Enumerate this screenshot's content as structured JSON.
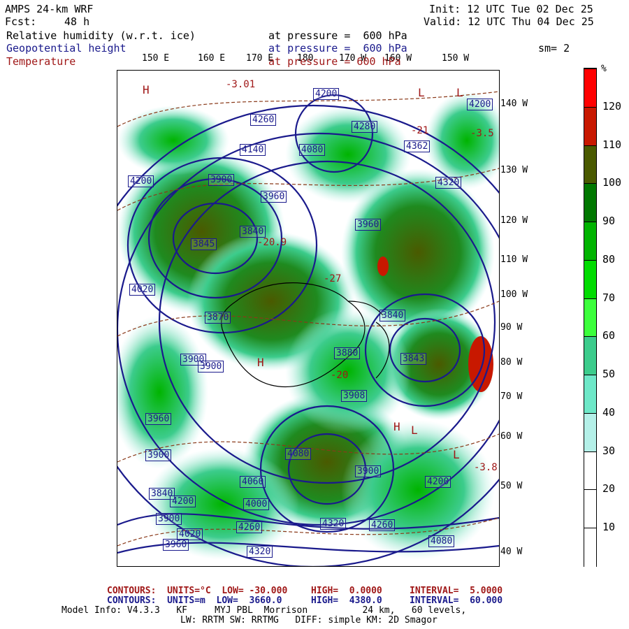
{
  "header": {
    "model": "AMPS 24-km WRF",
    "fcst_label": "Fcst:",
    "fcst_value": "48 h",
    "init": "Init: 12 UTC Tue 02 Dec 25",
    "valid": "Valid: 12 UTC Thu 04 Dec 25",
    "field1_name": "Relative humidity (w.r.t. ice)",
    "field1_level": "at pressure =  600 hPa",
    "field2_name": "Geopotential height",
    "field2_level": "at pressure =  600 hPa",
    "field3_name": "Temperature",
    "field3_level": "at pressure = 600 hPa",
    "smoothing": "sm= 2"
  },
  "lon_labels_top": [
    "150 E",
    "160 E",
    "170 E",
    "180",
    "170 W",
    "160 W",
    "150 W"
  ],
  "lat_lon_labels_right": [
    "140 W",
    "130 W",
    "120 W",
    "110 W",
    "100 W",
    "90 W",
    "80 W",
    "70 W",
    "60 W",
    "50 W",
    "40 W"
  ],
  "colorbar": {
    "unit": "%",
    "ticks": [
      "120",
      "110",
      "100",
      "90",
      "80",
      "70",
      "60",
      "50",
      "40",
      "30",
      "20",
      "10"
    ],
    "colors": [
      "#ff0000",
      "#c81800",
      "#4a5a00",
      "#007800",
      "#00b400",
      "#00dc00",
      "#3cff3c",
      "#3ccc8c",
      "#6ee8c8",
      "#b4f0e8",
      "#ffffff",
      "#ffffff",
      "#ffffff"
    ]
  },
  "map_labels": {
    "heights": [
      "4200",
      "4260",
      "4280",
      "4140",
      "4080",
      "4362",
      "4320",
      "4200",
      "3900",
      "3960",
      "3840",
      "3845",
      "3960",
      "4020",
      "3870",
      "3900",
      "3880",
      "3840",
      "3900",
      "3908",
      "3843",
      "3960",
      "3900",
      "3840",
      "3900",
      "3960",
      "4020",
      "4060",
      "4080",
      "3900",
      "4000",
      "4200",
      "4200",
      "4260",
      "4320",
      "4260",
      "4080",
      "4320",
      "4200"
    ],
    "temps": [
      "-3.01",
      "-21",
      "-3.5",
      "-20.9",
      "-27",
      "-20",
      "-3.8"
    ],
    "high_low": [
      "H",
      "L",
      "L",
      "H",
      "L",
      "H",
      "L"
    ]
  },
  "footer": {
    "line1_prefix": "CONTOURS:  UNITS=°C  LOW= -30.000",
    "line1_high": "HIGH=  0.0000",
    "line1_interval": "INTERVAL=  5.0000",
    "line2_prefix": "CONTOURS:  UNITS=m  LOW=  3660.0",
    "line2_high": "HIGH=  4380.0",
    "line2_interval": "INTERVAL=  60.000",
    "model_info": "Model Info: V4.3.3   KF     MYJ PBL  Morrison          24 km,   60 levels,",
    "model_info2": "LW: RRTM SW: RRTMG   DIFF: simple KM: 2D Smagor"
  }
}
